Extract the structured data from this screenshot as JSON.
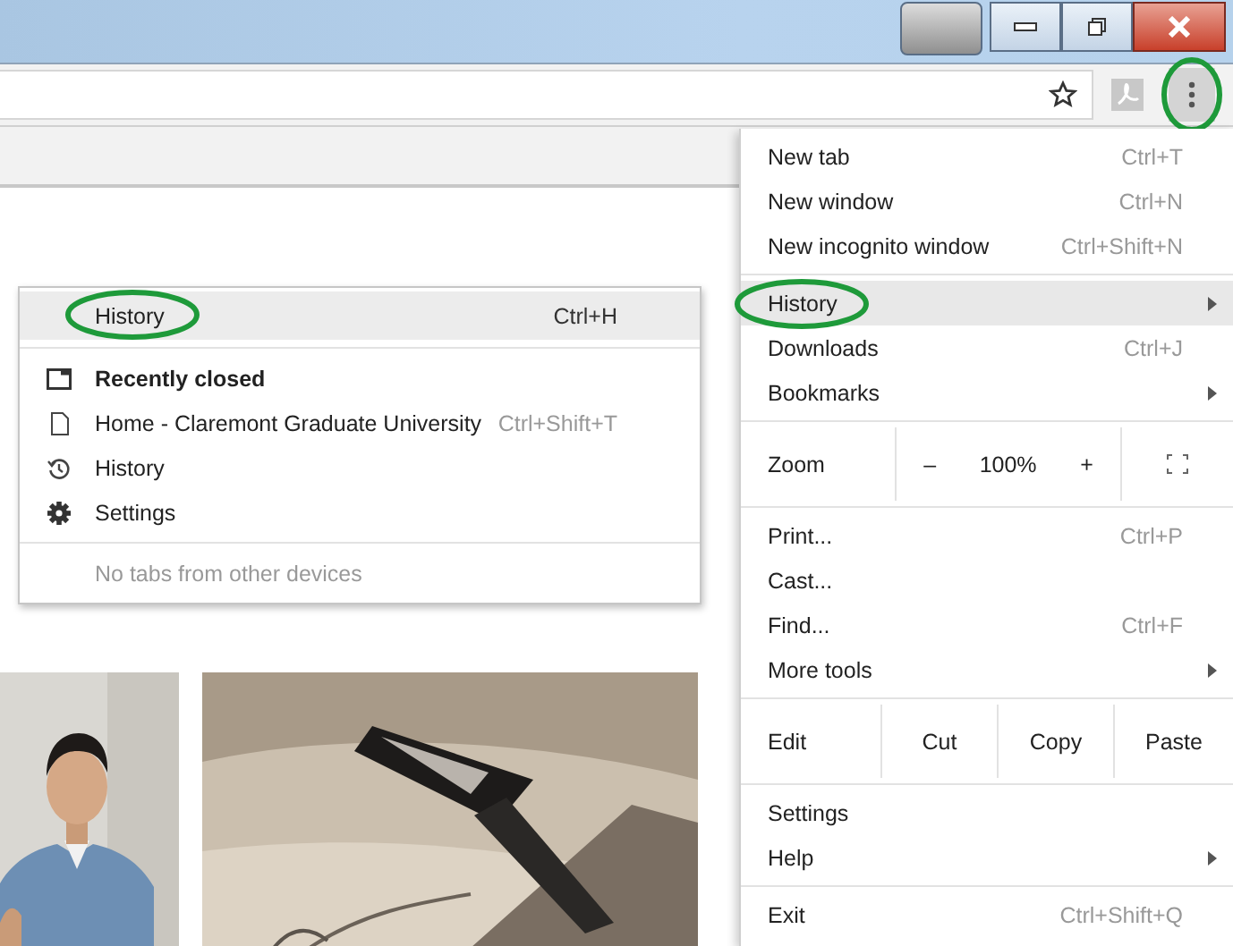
{
  "toolbar": {
    "menu_button_circled": true
  },
  "menu": {
    "items": [
      {
        "kind": "item",
        "label": "New tab",
        "shortcut": "Ctrl+T"
      },
      {
        "kind": "item",
        "label": "New window",
        "shortcut": "Ctrl+N"
      },
      {
        "kind": "item",
        "label": "New incognito window",
        "shortcut": "Ctrl+Shift+N"
      },
      {
        "kind": "separator"
      },
      {
        "kind": "item",
        "label": "History",
        "submenu": true,
        "selected": true,
        "circled": true
      },
      {
        "kind": "item",
        "label": "Downloads",
        "shortcut": "Ctrl+J"
      },
      {
        "kind": "item",
        "label": "Bookmarks",
        "submenu": true
      },
      {
        "kind": "separator"
      },
      {
        "kind": "zoom",
        "label": "Zoom",
        "minus": "–",
        "value": "100%",
        "plus": "+"
      },
      {
        "kind": "separator"
      },
      {
        "kind": "item",
        "label": "Print...",
        "shortcut": "Ctrl+P"
      },
      {
        "kind": "item",
        "label": "Cast..."
      },
      {
        "kind": "item",
        "label": "Find...",
        "shortcut": "Ctrl+F"
      },
      {
        "kind": "item",
        "label": "More tools",
        "submenu": true
      },
      {
        "kind": "separator"
      },
      {
        "kind": "edit",
        "label": "Edit",
        "buttons": [
          "Cut",
          "Copy",
          "Paste"
        ]
      },
      {
        "kind": "separator"
      },
      {
        "kind": "item",
        "label": "Settings"
      },
      {
        "kind": "item",
        "label": "Help",
        "submenu": true
      },
      {
        "kind": "separator"
      },
      {
        "kind": "item",
        "label": "Exit",
        "shortcut": "Ctrl+Shift+Q"
      }
    ]
  },
  "history_submenu": {
    "header": {
      "label": "History",
      "shortcut": "Ctrl+H",
      "selected": true,
      "circled": true
    },
    "recently_closed": "Recently closed",
    "entries": [
      {
        "kind": "page",
        "label": "Home - Claremont Graduate University",
        "shortcut": "Ctrl+Shift+T"
      },
      {
        "kind": "history",
        "label": "History"
      },
      {
        "kind": "settings",
        "label": "Settings"
      }
    ],
    "other_devices": "No tabs from other devices"
  }
}
